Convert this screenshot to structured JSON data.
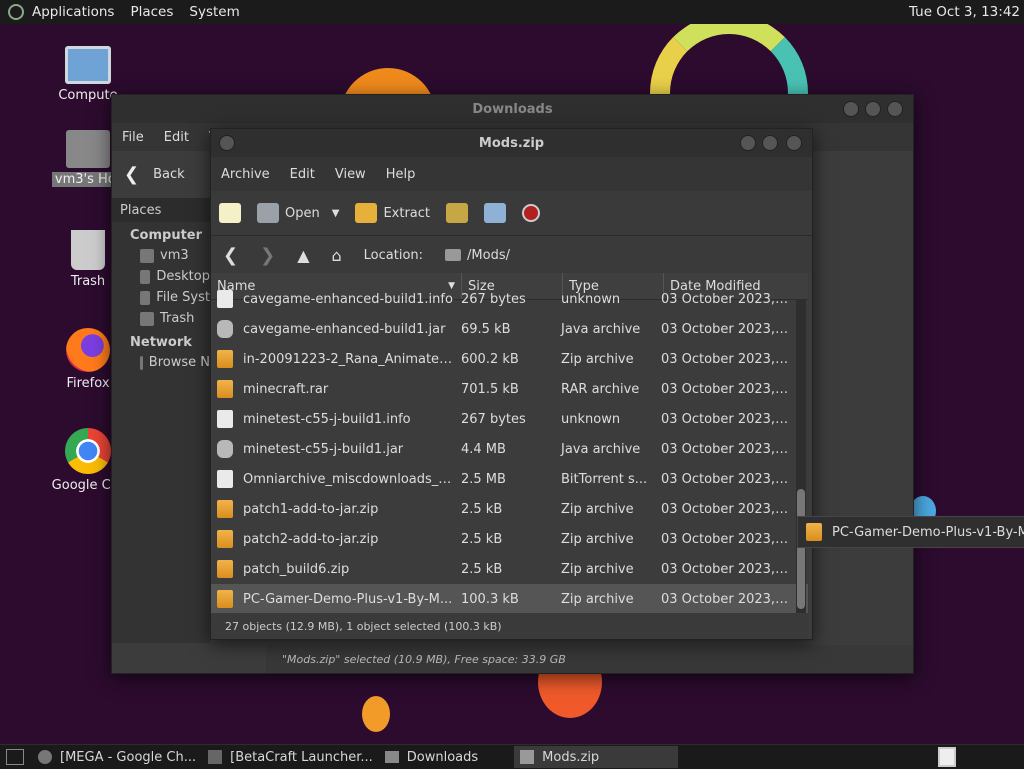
{
  "top_panel": {
    "menus": [
      "Applications",
      "Places",
      "System"
    ],
    "clock": "Tue Oct  3, 13:42"
  },
  "desktop": {
    "icons": [
      {
        "label": "Compute",
        "icon": "computer-icon"
      },
      {
        "label": "vm3's Hor",
        "icon": "home-folder-icon"
      },
      {
        "label": "Trash",
        "icon": "trash-icon"
      },
      {
        "label": "Firefox",
        "icon": "firefox-icon"
      },
      {
        "label": "Google Chr",
        "icon": "chrome-icon"
      }
    ]
  },
  "downloads_window": {
    "title": "Downloads",
    "menus": [
      "File",
      "Edit",
      "V"
    ],
    "back_label": "Back",
    "places_label": "Places",
    "sidebar": {
      "computer_header": "Computer",
      "computer_items": [
        "vm3",
        "Desktop",
        "File Syst",
        "Trash"
      ],
      "network_header": "Network",
      "network_items": [
        "Browse N"
      ]
    },
    "status": "\"Mods.zip\" selected (10.9 MB), Free space: 33.9 GB"
  },
  "archive_window": {
    "title": "Mods.zip",
    "menus": [
      "Archive",
      "Edit",
      "View",
      "Help"
    ],
    "toolbar": {
      "open": "Open",
      "extract": "Extract"
    },
    "location_label": "Location:",
    "location_value": "/Mods/",
    "columns": [
      "Name",
      "Size",
      "Type",
      "Date Modified"
    ],
    "rows": [
      {
        "name": "cavegame-enhanced-build1.info",
        "size": "267 bytes",
        "type": "unknown",
        "date": "03 October 2023, ...",
        "icon": "info"
      },
      {
        "name": "cavegame-enhanced-build1.jar",
        "size": "69.5 kB",
        "type": "Java archive",
        "date": "03 October 2023, ...",
        "icon": "jar"
      },
      {
        "name": "in-20091223-2_Rana_Animated...",
        "size": "600.2 kB",
        "type": "Zip archive",
        "date": "03 October 2023, ...",
        "icon": "zip"
      },
      {
        "name": "minecraft.rar",
        "size": "701.5 kB",
        "type": "RAR archive",
        "date": "03 October 2023, ...",
        "icon": "zip"
      },
      {
        "name": "minetest-c55-j-build1.info",
        "size": "267 bytes",
        "type": "unknown",
        "date": "03 October 2023, ...",
        "icon": "info"
      },
      {
        "name": "minetest-c55-j-build1.jar",
        "size": "4.4 MB",
        "type": "Java archive",
        "date": "03 October 2023, ...",
        "icon": "jar"
      },
      {
        "name": "Omniarchive_miscdownloads_G...",
        "size": "2.5 MB",
        "type": "BitTorrent s...",
        "date": "03 October 2023, ...",
        "icon": "tor"
      },
      {
        "name": "patch1-add-to-jar.zip",
        "size": "2.5 kB",
        "type": "Zip archive",
        "date": "03 October 2023, ...",
        "icon": "zip"
      },
      {
        "name": "patch2-add-to-jar.zip",
        "size": "2.5 kB",
        "type": "Zip archive",
        "date": "03 October 2023, ...",
        "icon": "zip"
      },
      {
        "name": "patch_build6.zip",
        "size": "2.5 kB",
        "type": "Zip archive",
        "date": "03 October 2023, ...",
        "icon": "zip"
      },
      {
        "name": "PC-Gamer-Demo-Plus-v1-By-M...",
        "size": "100.3 kB",
        "type": "Zip archive",
        "date": "03 October 2023, ...",
        "icon": "zip",
        "selected": true
      }
    ],
    "status": "27 objects (12.9 MB), 1 object selected (100.3 kB)"
  },
  "drag_item": {
    "label": "PC-Gamer-Demo-Plus-v1-By-M"
  },
  "taskbar": [
    {
      "label": "[MEGA - Google Ch...",
      "icon": "chrome-icon"
    },
    {
      "label": "[BetaCraft Launcher...",
      "icon": "java-icon"
    },
    {
      "label": "Downloads",
      "icon": "folder-icon"
    },
    {
      "label": "Mods.zip",
      "icon": "archive-icon",
      "active": true
    }
  ]
}
